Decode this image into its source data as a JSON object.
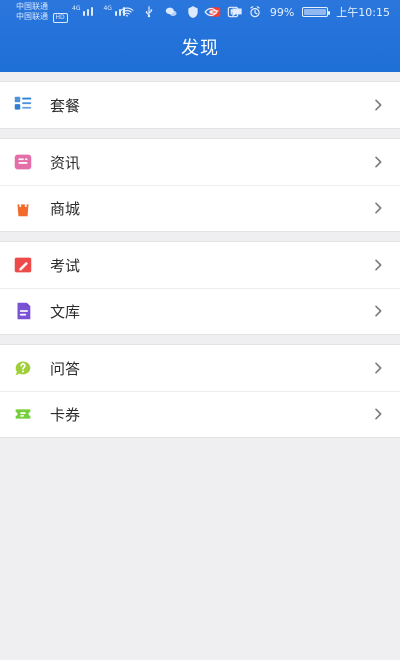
{
  "status_bar": {
    "carrier_line_1": "中国联通",
    "carrier_line_2": "中国联通",
    "hd_badge": "HD",
    "signal_tag_1": "4G",
    "signal_tag_2": "4G",
    "battery_percent": "99%",
    "time": "上午10:15"
  },
  "header": {
    "title": "发现"
  },
  "groups": [
    {
      "items": [
        {
          "label": "套餐",
          "icon": "package-icon",
          "color": "#2f7fd6"
        }
      ]
    },
    {
      "items": [
        {
          "label": "资讯",
          "icon": "news-icon",
          "color": "#e46ea8"
        },
        {
          "label": "商城",
          "icon": "shop-bag-icon",
          "color": "#f06b2c"
        }
      ]
    },
    {
      "items": [
        {
          "label": "考试",
          "icon": "exam-pencil-icon",
          "color": "#ef4a4a"
        },
        {
          "label": "文库",
          "icon": "library-doc-icon",
          "color": "#7a52d6"
        }
      ]
    },
    {
      "items": [
        {
          "label": "问答",
          "icon": "qa-bubble-icon",
          "color": "#9fd03a"
        },
        {
          "label": "卡券",
          "icon": "coupon-ticket-icon",
          "color": "#73cf3a"
        }
      ]
    }
  ],
  "colors": {
    "header_blue": "#1e6fd6",
    "background": "#efeff2",
    "chevron": "#7b7b7b"
  }
}
